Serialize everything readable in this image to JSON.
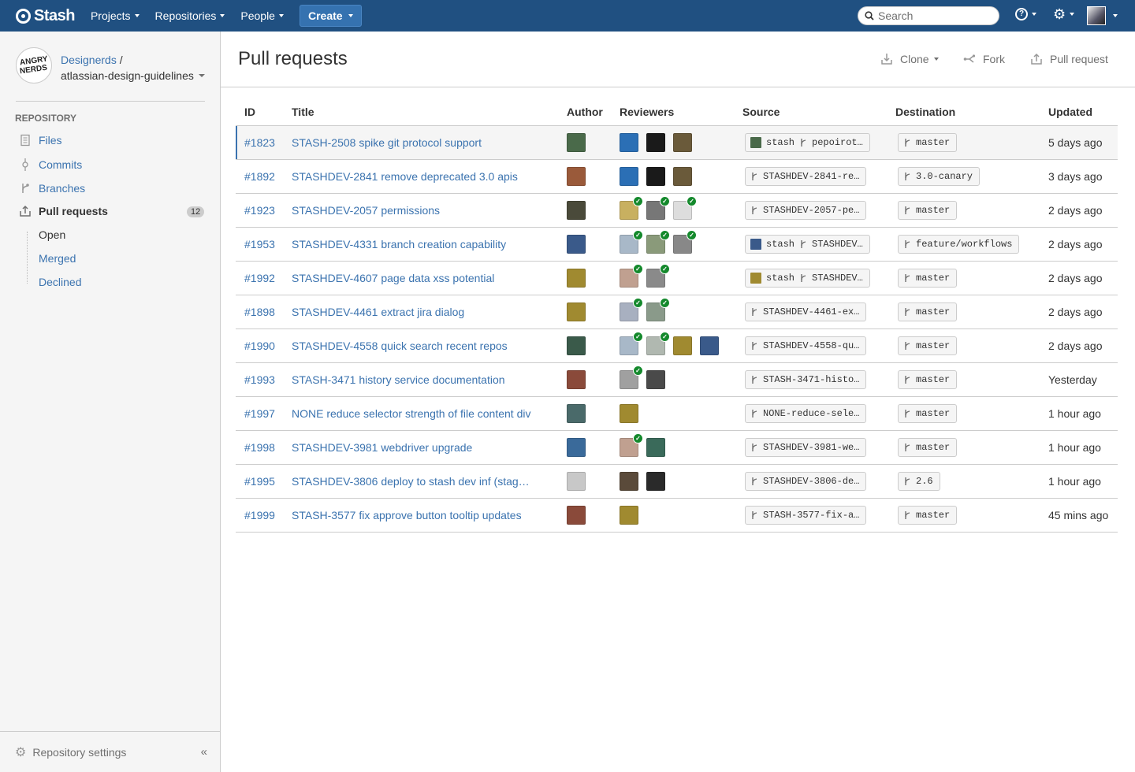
{
  "header": {
    "brand": "Stash",
    "nav": [
      {
        "label": "Projects"
      },
      {
        "label": "Repositories"
      },
      {
        "label": "People"
      }
    ],
    "create_label": "Create",
    "search_placeholder": "Search",
    "help_glyph": "?",
    "gear_glyph": "⚙"
  },
  "sidebar": {
    "project_name": "Designerds",
    "project_slash": "/",
    "repo_name": "atlassian-design-guidelines",
    "avatar_line1": "ANGRY",
    "avatar_line2": "NERDS",
    "section_heading": "Repository",
    "items": [
      {
        "label": "Files",
        "icon": "file-icon"
      },
      {
        "label": "Commits",
        "icon": "commit-icon"
      },
      {
        "label": "Branches",
        "icon": "branch-icon"
      },
      {
        "label": "Pull requests",
        "icon": "pull-request-icon",
        "count": "12"
      }
    ],
    "sub_items": [
      {
        "label": "Open"
      },
      {
        "label": "Merged"
      },
      {
        "label": "Declined"
      }
    ],
    "footer_label": "Repository settings",
    "collapse_glyph": "«"
  },
  "page": {
    "title": "Pull requests",
    "actions": {
      "clone": "Clone",
      "fork": "Fork",
      "pull_request": "Pull request"
    }
  },
  "table": {
    "columns": [
      "ID",
      "Title",
      "Author",
      "Reviewers",
      "Source",
      "Destination",
      "Updated"
    ],
    "rows": [
      {
        "id": "#1823",
        "title": "STASH-2508 spike git protocol support",
        "author": "#4a6a4a",
        "reviewers": [
          {
            "c": "#2b6fb5",
            "ok": false
          },
          {
            "c": "#1a1a1a",
            "ok": false
          },
          {
            "c": "#6a5a3a",
            "ok": false
          }
        ],
        "src_repo": "stash",
        "src_repo_c": "#4a6a4a",
        "source": "pepoirot…",
        "dest": "master",
        "updated": "5 days ago"
      },
      {
        "id": "#1892",
        "title": "STASHDEV-2841 remove deprecated 3.0 apis",
        "author": "#9a5a3a",
        "reviewers": [
          {
            "c": "#2b6fb5",
            "ok": false
          },
          {
            "c": "#1a1a1a",
            "ok": false
          },
          {
            "c": "#6a5a3a",
            "ok": false
          }
        ],
        "src_repo": "",
        "src_repo_c": "",
        "source": "STASHDEV-2841-re…",
        "dest": "3.0-canary",
        "updated": "3 days ago"
      },
      {
        "id": "#1923",
        "title": "STASHDEV-2057 permissions",
        "author": "#4a4a3a",
        "reviewers": [
          {
            "c": "#c8b060",
            "ok": true
          },
          {
            "c": "#777777",
            "ok": true
          },
          {
            "c": "#dddddd",
            "ok": true
          }
        ],
        "src_repo": "",
        "src_repo_c": "",
        "source": "STASHDEV-2057-pe…",
        "dest": "master",
        "updated": "2 days ago"
      },
      {
        "id": "#1953",
        "title": "STASHDEV-4331 branch creation capability",
        "author": "#3a5a8a",
        "reviewers": [
          {
            "c": "#a8b8c8",
            "ok": true
          },
          {
            "c": "#8a9a7a",
            "ok": true
          },
          {
            "c": "#888888",
            "ok": true
          }
        ],
        "src_repo": "stash",
        "src_repo_c": "#3a5a8a",
        "source": "STASHDEV…",
        "dest": "feature/workflows",
        "updated": "2 days ago"
      },
      {
        "id": "#1992",
        "title": "STASHDEV-4607 page data xss potential",
        "author": "#a08a30",
        "reviewers": [
          {
            "c": "#c0a090",
            "ok": true
          },
          {
            "c": "#8a8a8a",
            "ok": true
          }
        ],
        "src_repo": "stash",
        "src_repo_c": "#a08a30",
        "source": "STASHDEV…",
        "dest": "master",
        "updated": "2 days ago"
      },
      {
        "id": "#1898",
        "title": "STASHDEV-4461 extract jira dialog",
        "author": "#a08a30",
        "reviewers": [
          {
            "c": "#a8b0c0",
            "ok": true
          },
          {
            "c": "#8a9a8a",
            "ok": true
          }
        ],
        "src_repo": "",
        "src_repo_c": "",
        "source": "STASHDEV-4461-ex…",
        "dest": "master",
        "updated": "2 days ago"
      },
      {
        "id": "#1990",
        "title": "STASHDEV-4558 quick search recent repos",
        "author": "#3a5a4a",
        "reviewers": [
          {
            "c": "#a8b8c8",
            "ok": true
          },
          {
            "c": "#b0b8b0",
            "ok": true
          },
          {
            "c": "#a08a30",
            "ok": false
          },
          {
            "c": "#3a5a8a",
            "ok": false
          }
        ],
        "src_repo": "",
        "src_repo_c": "",
        "source": "STASHDEV-4558-qu…",
        "dest": "master",
        "updated": "2 days ago"
      },
      {
        "id": "#1993",
        "title": "STASH-3471 history service documentation",
        "author": "#8a4a3a",
        "reviewers": [
          {
            "c": "#a0a0a0",
            "ok": true
          },
          {
            "c": "#4a4a4a",
            "ok": false
          }
        ],
        "src_repo": "",
        "src_repo_c": "",
        "source": "STASH-3471-histo…",
        "dest": "master",
        "updated": "Yesterday"
      },
      {
        "id": "#1997",
        "title": "NONE reduce selector strength of file content div",
        "author": "#4a6a6a",
        "reviewers": [
          {
            "c": "#a08a30",
            "ok": false
          }
        ],
        "src_repo": "",
        "src_repo_c": "",
        "source": "NONE-reduce-sele…",
        "dest": "master",
        "updated": "1 hour ago"
      },
      {
        "id": "#1998",
        "title": "STASHDEV-3981 webdriver upgrade",
        "author": "#3a6a9a",
        "reviewers": [
          {
            "c": "#c0a090",
            "ok": true
          },
          {
            "c": "#3a6a5a",
            "ok": false
          }
        ],
        "src_repo": "",
        "src_repo_c": "",
        "source": "STASHDEV-3981-we…",
        "dest": "master",
        "updated": "1 hour ago"
      },
      {
        "id": "#1995",
        "title": "STASHDEV-3806 deploy to stash dev inf (stag…",
        "author": "#c8c8c8",
        "reviewers": [
          {
            "c": "#5a4a3a",
            "ok": false
          },
          {
            "c": "#2a2a2a",
            "ok": false
          }
        ],
        "src_repo": "",
        "src_repo_c": "",
        "source": "STASHDEV-3806-de…",
        "dest": "2.6",
        "updated": "1 hour ago"
      },
      {
        "id": "#1999",
        "title": "STASH-3577 fix approve button tooltip updates",
        "author": "#8a4a3a",
        "reviewers": [
          {
            "c": "#a08a30",
            "ok": false
          }
        ],
        "src_repo": "",
        "src_repo_c": "",
        "source": "STASH-3577-fix-a…",
        "dest": "master",
        "updated": "45 mins ago"
      }
    ]
  },
  "colors": {
    "header_bg": "#205081",
    "link": "#3b73af",
    "approved": "#14892c"
  }
}
